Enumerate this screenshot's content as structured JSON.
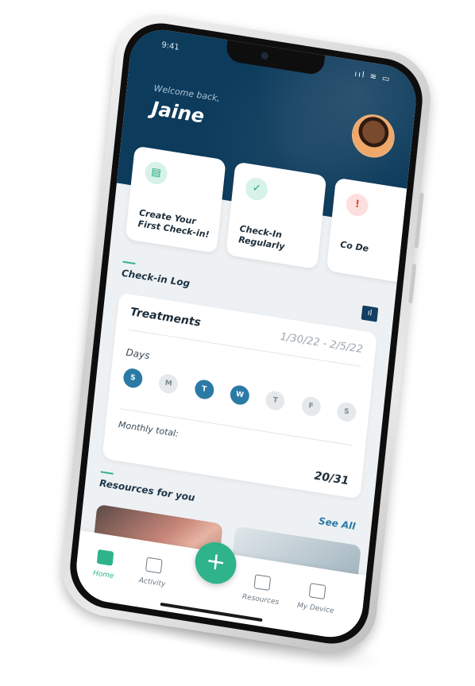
{
  "status": {
    "time": "9:41",
    "icons": "ııl ≋ ▭"
  },
  "header": {
    "welcome": "Welcome back,",
    "user_name": "Jaine"
  },
  "cards": [
    {
      "label": "Create Your First Check-in!",
      "icon": "doc-plus-icon"
    },
    {
      "label": "Check-In Regularly",
      "icon": "doc-check-icon"
    },
    {
      "label": "Co De",
      "icon": "alert-icon"
    }
  ],
  "checkin_log": {
    "title": "Check-in Log",
    "chart_button": "ıl"
  },
  "treatments": {
    "title": "Treatments",
    "date_range": "1/30/22 - 2/5/22",
    "days_label": "Days",
    "days": [
      {
        "letter": "S",
        "on": true
      },
      {
        "letter": "M",
        "on": false
      },
      {
        "letter": "T",
        "on": true
      },
      {
        "letter": "W",
        "on": true
      },
      {
        "letter": "T",
        "on": false
      },
      {
        "letter": "F",
        "on": false
      },
      {
        "letter": "S",
        "on": false
      }
    ],
    "monthly_label": "Monthly total:",
    "monthly_value": "20/31"
  },
  "resources": {
    "title": "Resources for you",
    "see_all": "See All"
  },
  "tabbar": {
    "home": "Home",
    "activity": "Activity",
    "add": "+",
    "resources": "Resources",
    "device": "My Device"
  },
  "colors": {
    "header": "#0d3b5c",
    "accent": "#2fb38a",
    "day_active": "#2a7aa6"
  }
}
